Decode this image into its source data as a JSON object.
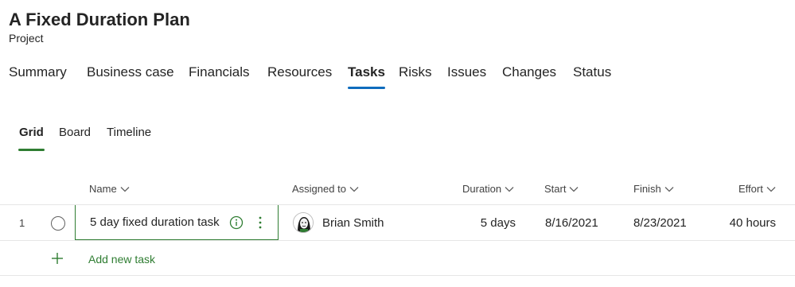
{
  "header": {
    "title": "A Fixed Duration Plan",
    "subtitle": "Project"
  },
  "main_tabs": [
    {
      "label": "Summary",
      "active": false
    },
    {
      "label": "Business case",
      "active": false
    },
    {
      "label": "Financials",
      "active": false
    },
    {
      "label": "Resources",
      "active": false
    },
    {
      "label": "Tasks",
      "active": true
    },
    {
      "label": "Risks",
      "active": false
    },
    {
      "label": "Issues",
      "active": false
    },
    {
      "label": "Changes",
      "active": false
    },
    {
      "label": "Status",
      "active": false
    }
  ],
  "view_tabs": [
    {
      "label": "Grid",
      "active": true
    },
    {
      "label": "Board",
      "active": false
    },
    {
      "label": "Timeline",
      "active": false
    }
  ],
  "grid": {
    "columns": {
      "name": "Name",
      "assigned_to": "Assigned to",
      "duration": "Duration",
      "start": "Start",
      "finish": "Finish",
      "effort": "Effort"
    },
    "rows": [
      {
        "number": "1",
        "name": "5 day fixed duration task",
        "assigned_to": "Brian Smith",
        "duration": "5 days",
        "start": "8/16/2021",
        "finish": "8/23/2021",
        "effort": "40 hours"
      }
    ],
    "add_label": "Add new task"
  },
  "colors": {
    "accent_blue": "#0f6cbd",
    "accent_green": "#2f7d32",
    "text": "#242424",
    "divider": "#e6e6e6"
  },
  "icons": [
    "chevron-down-icon",
    "circle-checkbox-icon",
    "info-icon",
    "more-vertical-icon",
    "avatar-icon",
    "plus-icon"
  ]
}
